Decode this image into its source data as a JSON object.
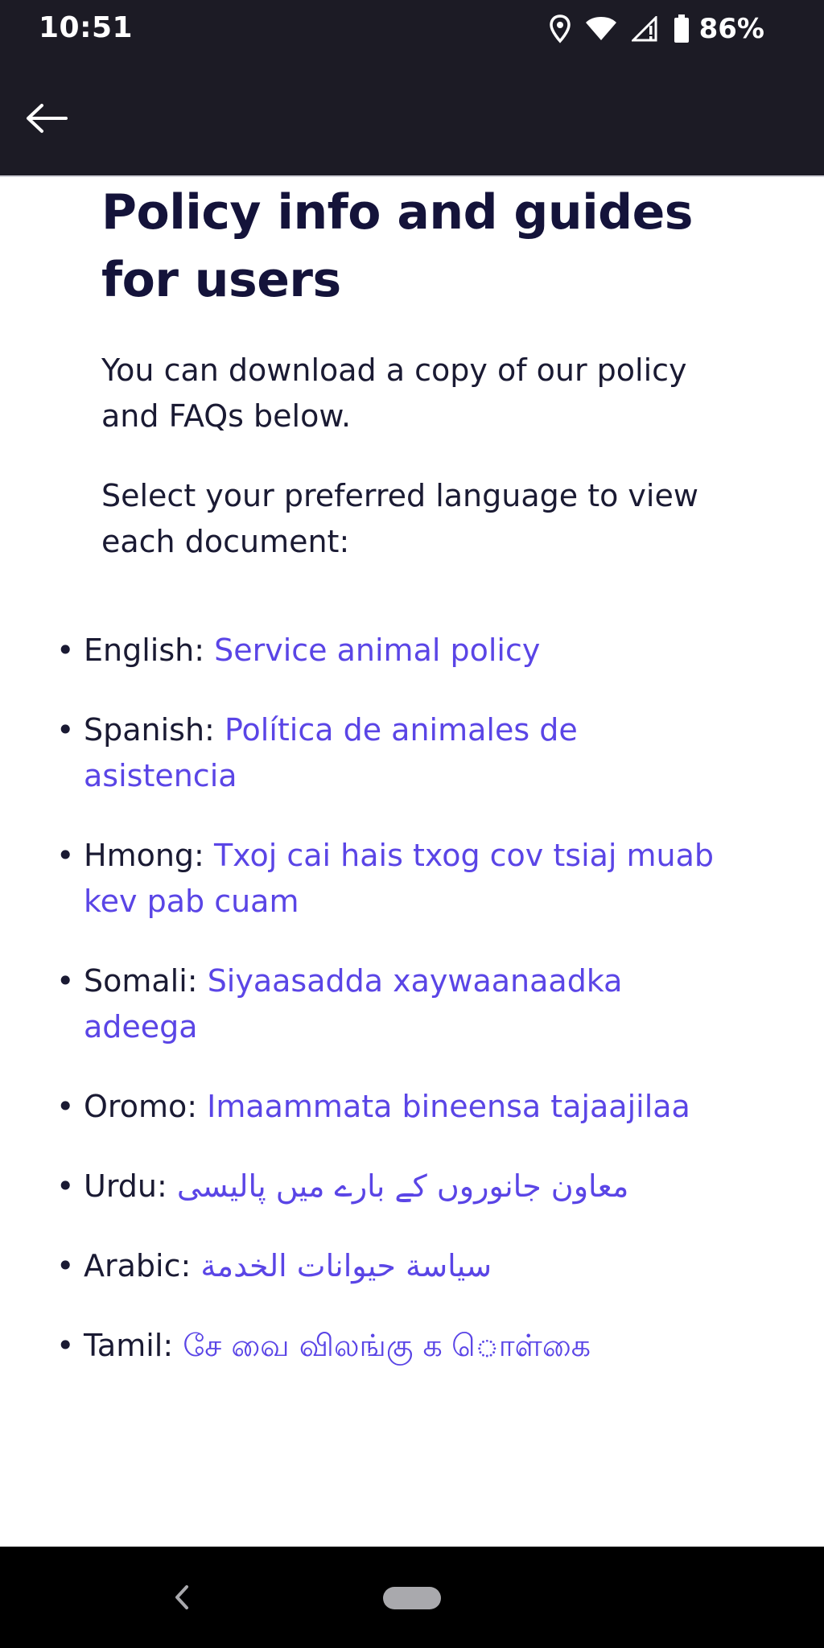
{
  "status_bar": {
    "time": "10:51",
    "battery": "86%",
    "icons": [
      "location-icon",
      "wifi-icon",
      "cell-signal-icon",
      "battery-icon"
    ]
  },
  "app_bar": {
    "back_icon": "arrow-left-icon"
  },
  "main": {
    "title": "Policy info and guides for users",
    "intro": "You can download a copy of our policy and FAQs below.",
    "instruction": "Select your preferred language to view each document:",
    "languages": [
      {
        "language": "English:",
        "link": "Service animal policy"
      },
      {
        "language": "Spanish:",
        "link": "Política de animales de asistencia"
      },
      {
        "language": "Hmong:",
        "link": "Txoj cai hais txog cov tsiaj muab kev pab cuam"
      },
      {
        "language": "Somali:",
        "link": "Siyaasadda xaywaanaadka adeega"
      },
      {
        "language": "Oromo:",
        "link": "Imaammata bineensa tajaajilaa"
      },
      {
        "language": "Urdu:",
        "link": "معاون جانوروں کے بارے میں پالیسی"
      },
      {
        "language": "Arabic:",
        "link": "سياسة حيوانات الخدمة"
      },
      {
        "language": "Tamil:",
        "link": "சே வை விலங்கு க ொள்கை"
      }
    ]
  },
  "nav_bar": {
    "icons": [
      "nav-back-icon",
      "home-pill-icon"
    ]
  },
  "colors": {
    "bar_background": "#1c1b25",
    "link": "#5a45e6",
    "title": "#14133a",
    "body_text": "#1a1a33"
  }
}
